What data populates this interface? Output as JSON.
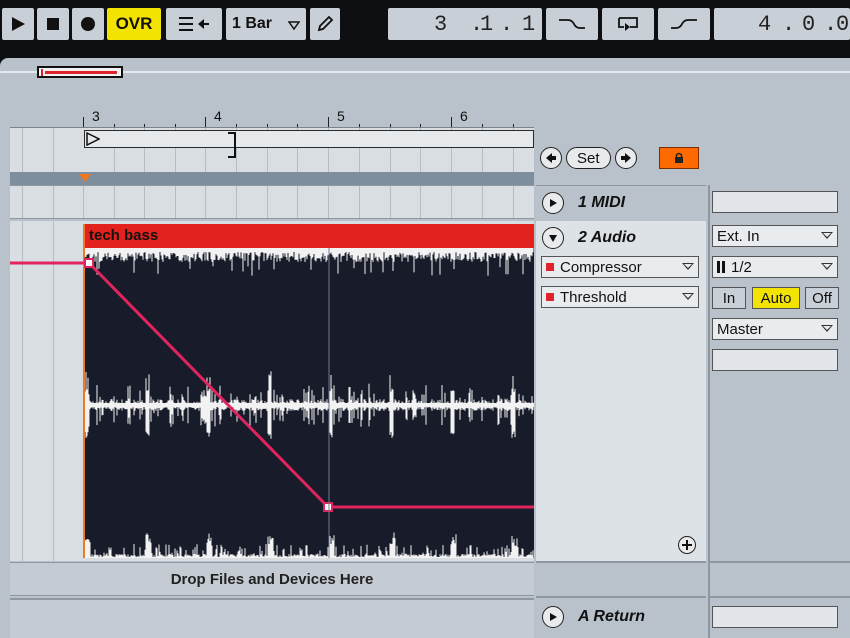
{
  "transport": {
    "play_icon": "play-icon",
    "stop_icon": "stop-icon",
    "record_icon": "record-icon",
    "ovr_label": "OVR",
    "quantize_label": "1 Bar",
    "position": [
      "3",
      "1",
      "1"
    ],
    "loop_length": [
      "4",
      "0",
      "0"
    ]
  },
  "ruler": {
    "marks": [
      "3",
      "4",
      "5",
      "6"
    ]
  },
  "locators": {
    "set_label": "Set"
  },
  "tracks": {
    "midi": {
      "name": "1 MIDI"
    },
    "audio": {
      "name": "2 Audio",
      "clip_name": "tech bass",
      "device": "Compressor",
      "parameter": "Threshold",
      "input_type": "Ext. In",
      "input_channel": "1/2",
      "monitor": [
        "In",
        "Auto",
        "Off"
      ],
      "monitor_active": "Auto",
      "output": "Master"
    },
    "return": {
      "name": "A Return"
    }
  },
  "drop_zone": {
    "label": "Drop Files and Devices Here"
  },
  "colors": {
    "clip": "#e3221e",
    "automation": "#e0245e",
    "waveform_bg": "#181c2a",
    "ovr": "#f3e300",
    "lock": "#ff6a00"
  }
}
